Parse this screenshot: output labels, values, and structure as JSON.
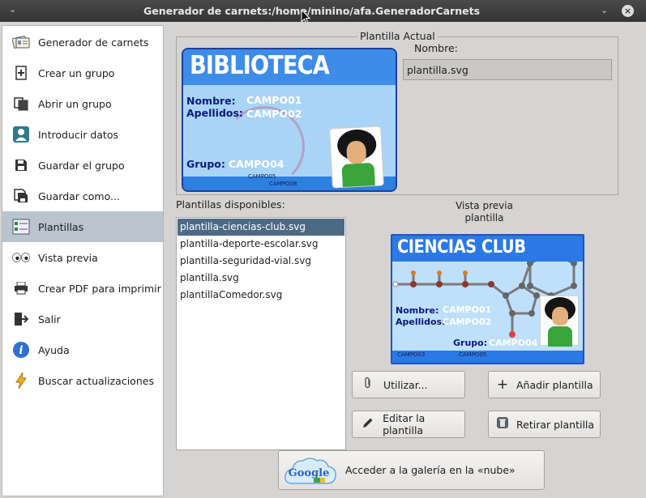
{
  "window": {
    "title": "Generador de carnets:/home/minino/afa.GeneradorCarnets"
  },
  "sidebar": {
    "items": [
      {
        "label": "Generador de carnets",
        "icon": "id-cards-icon"
      },
      {
        "label": "Crear un grupo",
        "icon": "new-document-icon"
      },
      {
        "label": "Abrir un grupo",
        "icon": "open-folder-icon"
      },
      {
        "label": "Introducir datos",
        "icon": "user-icon"
      },
      {
        "label": "Guardar el grupo",
        "icon": "save-icon"
      },
      {
        "label": "Guardar como...",
        "icon": "save-as-icon"
      },
      {
        "label": "Plantillas",
        "icon": "template-icon",
        "active": true
      },
      {
        "label": "Vista previa",
        "icon": "eyes-icon"
      },
      {
        "label": "Crear PDF para imprimir",
        "icon": "printer-icon"
      },
      {
        "label": "Salir",
        "icon": "exit-icon"
      },
      {
        "label": "Ayuda",
        "icon": "info-icon"
      },
      {
        "label": "Buscar actualizaciones",
        "icon": "lightning-icon"
      }
    ]
  },
  "current_template": {
    "group_title": "Plantilla Actual",
    "name_label": "Nombre:",
    "name_value": "plantilla.svg",
    "card": {
      "header": "BIBLIOTECA",
      "label_nombre": "Nombre:",
      "label_apellidos": "Apellidos:",
      "label_grupo": "Grupo:",
      "campo01": "CAMPO01",
      "campo02": "CAMPO02",
      "campo04": "CAMPO04",
      "campo05": "CAMPO05",
      "campo08": "CAMPO08"
    }
  },
  "available": {
    "label": "Plantillas disponibles:",
    "items": [
      "plantilla-ciencias-club.svg",
      "plantilla-deporte-escolar.svg",
      "plantilla-seguridad-vial.svg",
      "plantilla.svg",
      "plantillaComedor.svg"
    ],
    "selected_index": 0
  },
  "preview": {
    "label_line1": "Vista previa",
    "label_line2": "plantilla",
    "card": {
      "header": "CIENCIAS CLUB",
      "label_nombre": "Nombre:",
      "label_apellidos": "Apellidos:",
      "label_grupo": "Grupo:",
      "campo01": "CAMPO01",
      "campo02": "CAMPO02",
      "campo04": "CAMPO04",
      "campo03": "CAMPO03",
      "campo05": "CAMPO05"
    }
  },
  "buttons": {
    "use": "Utilizar...",
    "add": "Añadir plantilla",
    "edit": "Editar la plantilla",
    "remove": "Retirar plantilla",
    "gallery": "Acceder a la galería en la «nube»",
    "gallery_logo": "Google"
  },
  "colors": {
    "sidebar_active": "#b9c4cf",
    "list_selected": "#4d6a85",
    "card_blue": "#2a79e6"
  }
}
